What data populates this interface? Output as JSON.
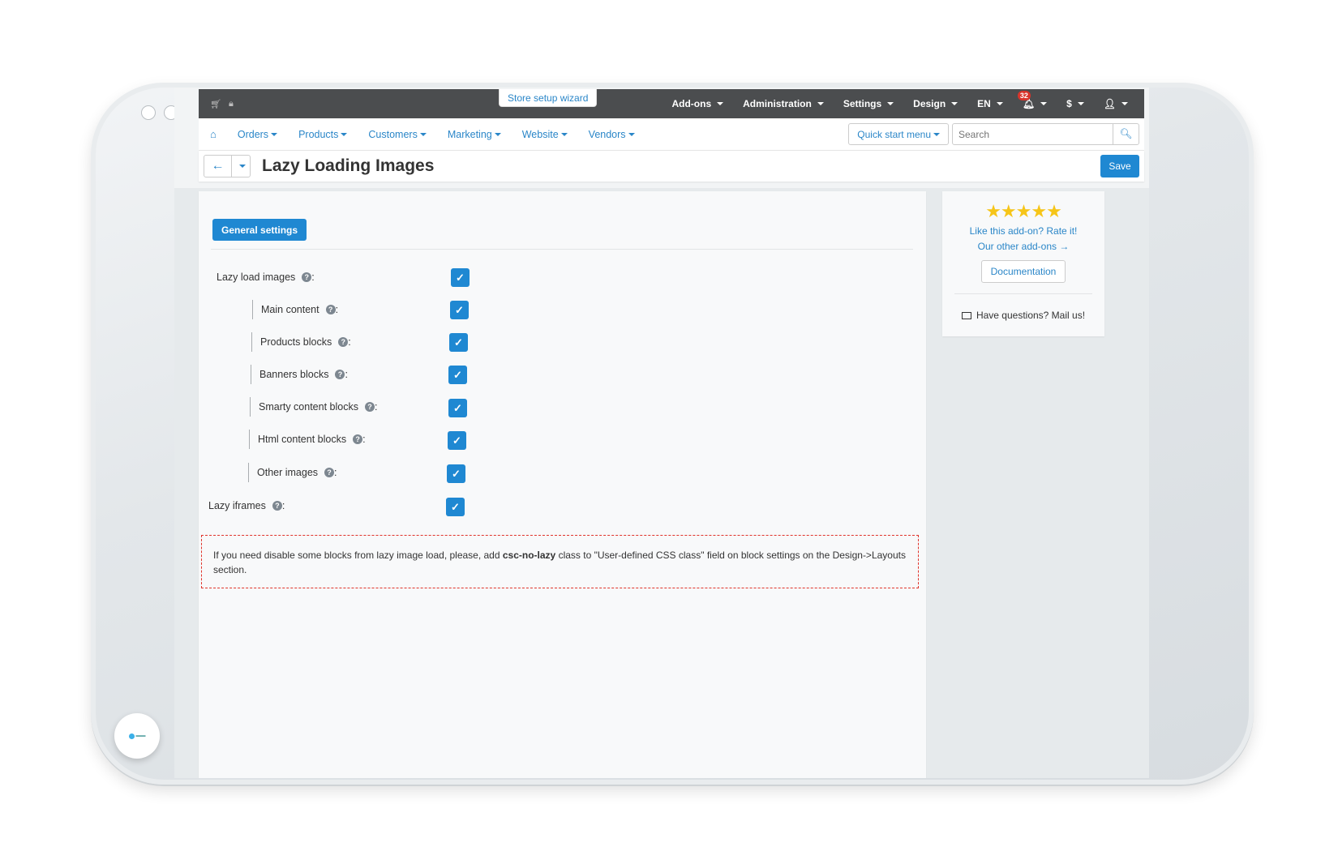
{
  "topbar": {
    "wizard_label": "Store setup wizard",
    "menu": [
      "Add-ons",
      "Administration",
      "Settings",
      "Design",
      "EN",
      "$"
    ],
    "notifications_count": "32",
    "icons": [
      "cart-icon",
      "lock-icon",
      "bell-icon",
      "user-icon"
    ]
  },
  "navbar": {
    "items": [
      "Orders",
      "Products",
      "Customers",
      "Marketing",
      "Website",
      "Vendors"
    ],
    "quick_start_label": "Quick start menu",
    "search_placeholder": "Search"
  },
  "titlebar": {
    "title": "Lazy Loading Images",
    "save_label": "Save"
  },
  "settings": {
    "tab_label": "General settings",
    "fields": [
      {
        "label": "Lazy load images",
        "checked": true
      },
      {
        "label": "Main content",
        "checked": true
      },
      {
        "label": "Products blocks",
        "checked": true
      },
      {
        "label": "Banners blocks",
        "checked": true
      },
      {
        "label": "Smarty content blocks",
        "checked": true
      },
      {
        "label": "Html content blocks",
        "checked": true
      },
      {
        "label": "Other images",
        "checked": true
      },
      {
        "label": "Lazy iframes",
        "checked": true
      }
    ],
    "colon": ":",
    "notice_before": "If you need disable some blocks from lazy image load, please, add ",
    "notice_code": "csc-no-lazy",
    "notice_after": " class to \"User-defined CSS class\" field on block settings on the Design->Layouts section."
  },
  "sidebar": {
    "stars": "★★★★★",
    "rating": 5,
    "rate_label": "Like this add-on? Rate it!",
    "other_label": "Our other add-ons →",
    "doc_label": "Documentation",
    "mail_label": "Have questions? Mail us!"
  },
  "colors": {
    "accent": "#1f88d2",
    "topbar": "#4b4d4f",
    "link": "#2a86c8",
    "star": "#f6c518",
    "notice_border": "#e0342b",
    "badge": "#d9342b"
  }
}
